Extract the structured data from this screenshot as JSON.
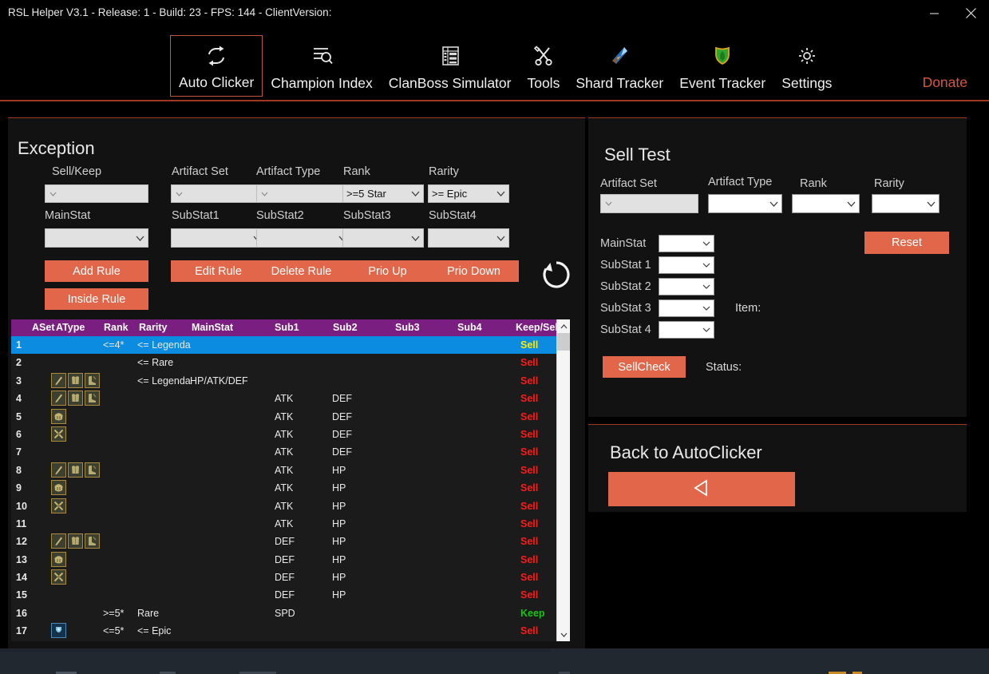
{
  "window": {
    "title": "RSL Helper V3.1 - Release: 1 - Build: 23 - FPS: 144 - ClientVersion:",
    "minimize_label": "Minimize",
    "close_label": "Close"
  },
  "nav": {
    "items": [
      {
        "label": "Auto Clicker",
        "icon": "repeat-icon",
        "active": true
      },
      {
        "label": "Champion Index",
        "icon": "list-search-icon",
        "active": false
      },
      {
        "label": "ClanBoss Simulator",
        "icon": "table-grid-icon",
        "active": false
      },
      {
        "label": "Tools",
        "icon": "wrench-screwdriver-icon",
        "active": false
      },
      {
        "label": "Shard Tracker",
        "icon": "shard-crystal-icon",
        "active": false
      },
      {
        "label": "Event Tracker",
        "icon": "shield-icon",
        "active": false
      },
      {
        "label": "Settings",
        "icon": "gear-icon",
        "active": false
      }
    ],
    "donate_label": "Donate"
  },
  "exception": {
    "title": "Exception",
    "refresh_icon": "refresh-icon",
    "fields": {
      "sell_keep": {
        "label": "Sell/Keep",
        "value": ""
      },
      "artifact_set": {
        "label": "Artifact Set",
        "value": ""
      },
      "artifact_type": {
        "label": "Artifact Type",
        "value": ""
      },
      "rank": {
        "label": "Rank",
        "value": ">=5 Star"
      },
      "rarity": {
        "label": "Rarity",
        "value": ">= Epic"
      },
      "mainstat": {
        "label": "MainStat",
        "value": ""
      },
      "substat1": {
        "label": "SubStat1",
        "value": ""
      },
      "substat2": {
        "label": "SubStat2",
        "value": ""
      },
      "substat3": {
        "label": "SubStat3",
        "value": ""
      },
      "substat4": {
        "label": "SubStat4",
        "value": ""
      }
    },
    "buttons": {
      "add_rule": "Add Rule",
      "inside_rule": "Inside Rule",
      "edit_rule": "Edit Rule",
      "delete_rule": "Delete Rule",
      "prio_up": "Prio Up",
      "prio_down": "Prio Down"
    }
  },
  "rules_table": {
    "columns": [
      "",
      "ASet",
      "AType",
      "Rank",
      "Rarity",
      "MainStat",
      "Sub1",
      "Sub2",
      "Sub3",
      "Sub4",
      "Keep/Sell"
    ],
    "rows": [
      {
        "num": "1",
        "aset": "",
        "icons": [],
        "rank": "<=4*",
        "rarity": "<= Legenda",
        "mainstat": "",
        "sub1": "",
        "sub2": "",
        "sub3": "",
        "sub4": "",
        "keepsell": "Sell",
        "selected": true
      },
      {
        "num": "2",
        "aset": "",
        "icons": [],
        "rank": "",
        "rarity": "<= Rare",
        "mainstat": "",
        "sub1": "",
        "sub2": "",
        "sub3": "",
        "sub4": "",
        "keepsell": "Sell",
        "selected": false
      },
      {
        "num": "3",
        "aset": "",
        "icons": [
          "weapon",
          "chest",
          "boots"
        ],
        "rank": "",
        "rarity": "<= Legenda",
        "mainstat": "HP/ATK/DEF",
        "sub1": "",
        "sub2": "",
        "sub3": "",
        "sub4": "",
        "keepsell": "Sell",
        "selected": false
      },
      {
        "num": "4",
        "aset": "",
        "icons": [
          "weapon",
          "chest",
          "boots"
        ],
        "rank": "",
        "rarity": "",
        "mainstat": "",
        "sub1": "ATK",
        "sub2": "DEF",
        "sub3": "",
        "sub4": "",
        "keepsell": "Sell",
        "selected": false
      },
      {
        "num": "5",
        "aset": "",
        "icons": [
          "helmet"
        ],
        "rank": "",
        "rarity": "",
        "mainstat": "",
        "sub1": "ATK",
        "sub2": "DEF",
        "sub3": "",
        "sub4": "",
        "keepsell": "Sell",
        "selected": false
      },
      {
        "num": "6",
        "aset": "",
        "icons": [
          "gauntlets"
        ],
        "rank": "",
        "rarity": "",
        "mainstat": "",
        "sub1": "ATK",
        "sub2": "DEF",
        "sub3": "",
        "sub4": "",
        "keepsell": "Sell",
        "selected": false
      },
      {
        "num": "7",
        "aset": "",
        "icons": [],
        "rank": "",
        "rarity": "",
        "mainstat": "",
        "sub1": "ATK",
        "sub2": "DEF",
        "sub3": "",
        "sub4": "",
        "keepsell": "Sell",
        "selected": false
      },
      {
        "num": "8",
        "aset": "",
        "icons": [
          "weapon",
          "chest",
          "boots"
        ],
        "rank": "",
        "rarity": "",
        "mainstat": "",
        "sub1": "ATK",
        "sub2": "HP",
        "sub3": "",
        "sub4": "",
        "keepsell": "Sell",
        "selected": false
      },
      {
        "num": "9",
        "aset": "",
        "icons": [
          "helmet"
        ],
        "rank": "",
        "rarity": "",
        "mainstat": "",
        "sub1": "ATK",
        "sub2": "HP",
        "sub3": "",
        "sub4": "",
        "keepsell": "Sell",
        "selected": false
      },
      {
        "num": "10",
        "aset": "",
        "icons": [
          "gauntlets"
        ],
        "rank": "",
        "rarity": "",
        "mainstat": "",
        "sub1": "ATK",
        "sub2": "HP",
        "sub3": "",
        "sub4": "",
        "keepsell": "Sell",
        "selected": false
      },
      {
        "num": "11",
        "aset": "",
        "icons": [],
        "rank": "",
        "rarity": "",
        "mainstat": "",
        "sub1": "ATK",
        "sub2": "HP",
        "sub3": "",
        "sub4": "",
        "keepsell": "Sell",
        "selected": false
      },
      {
        "num": "12",
        "aset": "",
        "icons": [
          "weapon",
          "chest",
          "boots"
        ],
        "rank": "",
        "rarity": "",
        "mainstat": "",
        "sub1": "DEF",
        "sub2": "HP",
        "sub3": "",
        "sub4": "",
        "keepsell": "Sell",
        "selected": false
      },
      {
        "num": "13",
        "aset": "",
        "icons": [
          "helmet"
        ],
        "rank": "",
        "rarity": "",
        "mainstat": "",
        "sub1": "DEF",
        "sub2": "HP",
        "sub3": "",
        "sub4": "",
        "keepsell": "Sell",
        "selected": false
      },
      {
        "num": "14",
        "aset": "",
        "icons": [
          "gauntlets"
        ],
        "rank": "",
        "rarity": "",
        "mainstat": "",
        "sub1": "DEF",
        "sub2": "HP",
        "sub3": "",
        "sub4": "",
        "keepsell": "Sell",
        "selected": false
      },
      {
        "num": "15",
        "aset": "",
        "icons": [],
        "rank": "",
        "rarity": "",
        "mainstat": "",
        "sub1": "DEF",
        "sub2": "HP",
        "sub3": "",
        "sub4": "",
        "keepsell": "Sell",
        "selected": false
      },
      {
        "num": "16",
        "aset": "",
        "icons": [],
        "rank": ">=5*",
        "rarity": "Rare",
        "mainstat": "",
        "sub1": "SPD",
        "sub2": "",
        "sub3": "",
        "sub4": "",
        "keepsell": "Keep",
        "selected": false
      },
      {
        "num": "17",
        "aset": "",
        "icons": [
          "accessory"
        ],
        "rank": "<=5*",
        "rarity": "<= Epic",
        "mainstat": "",
        "sub1": "",
        "sub2": "",
        "sub3": "",
        "sub4": "",
        "keepsell": "Sell",
        "selected": false
      }
    ]
  },
  "sell_test": {
    "title": "Sell Test",
    "fields": {
      "artifact_set": {
        "label": "Artifact Set",
        "value": ""
      },
      "artifact_type": {
        "label": "Artifact Type",
        "value": ""
      },
      "rank": {
        "label": "Rank",
        "value": ""
      },
      "rarity": {
        "label": "Rarity",
        "value": ""
      },
      "mainstat": {
        "label": "MainStat",
        "value": ""
      },
      "substat1": {
        "label": "SubStat 1",
        "value": ""
      },
      "substat2": {
        "label": "SubStat 2",
        "value": ""
      },
      "substat3": {
        "label": "SubStat 3",
        "value": ""
      },
      "substat4": {
        "label": "SubStat 4",
        "value": ""
      }
    },
    "item_label": "Item:",
    "item_value": "",
    "status_label": "Status:",
    "status_value": "",
    "reset_label": "Reset",
    "sellcheck_label": "SellCheck"
  },
  "back_panel": {
    "title": "Back to AutoClicker",
    "button_icon": "left-triangle-icon"
  },
  "colors": {
    "accent_orange": "#e2664a",
    "panel_border": "#9e3a22",
    "header_purple": "#7b1e82",
    "row_selected_blue": "#0b8ce0",
    "sell_red": "#ff1a1a",
    "keep_green": "#15c415",
    "donate_orange": "#d9563a",
    "panel_bg": "#121212",
    "app_bg": "#000000"
  }
}
